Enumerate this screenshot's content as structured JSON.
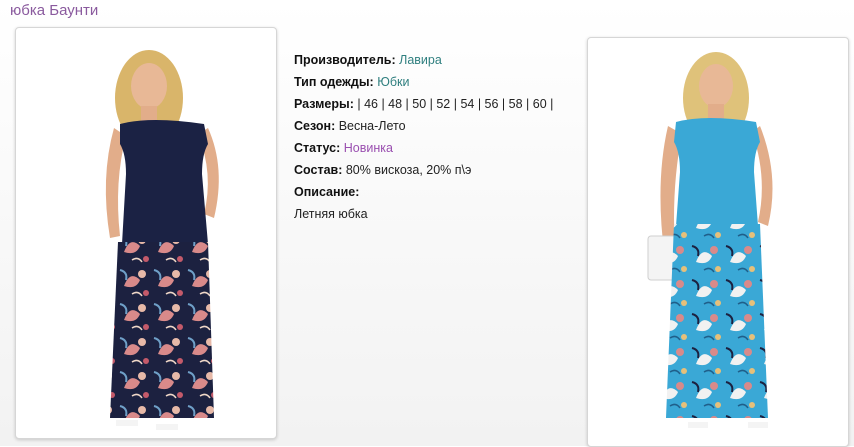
{
  "page": {
    "title": "юбка Баунти"
  },
  "specs": {
    "manufacturer": {
      "label": "Производитель:",
      "value": "Лавира"
    },
    "clothing_type": {
      "label": "Тип одежды:",
      "value": "Юбки"
    },
    "sizes": {
      "label": "Размеры:",
      "value": "| 46 | 48 | 50 | 52 | 54 | 56 | 58 | 60 |"
    },
    "season": {
      "label": "Сезон:",
      "value": "Весна-Лето"
    },
    "status": {
      "label": "Статус:",
      "value": "Новинка"
    },
    "composition": {
      "label": "Состав:",
      "value": "80% вискоза, 20% п\\э"
    },
    "description": {
      "label": "Описание:",
      "value": "Летняя юбка"
    }
  },
  "colors": {
    "title": "#8a5a9e",
    "link_teal": "#2f7f7f",
    "link_purple": "#9a4fb0",
    "left_top": "#1b2244",
    "right_top": "#3aa8d6"
  },
  "images": [
    {
      "name": "product-photo-navy",
      "icon": "model-photo"
    },
    {
      "name": "product-photo-blue",
      "icon": "model-photo"
    }
  ]
}
